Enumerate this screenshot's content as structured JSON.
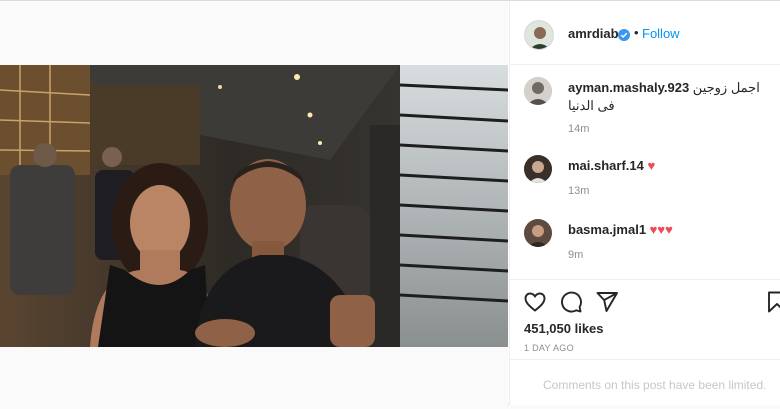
{
  "post": {
    "owner": {
      "username": "amrdiab",
      "verified_icon": "verified-badge-icon",
      "follow_label": "Follow",
      "separator": "•"
    },
    "comments": [
      {
        "username": "ayman.mashaly.923",
        "text": "اجمل زوجين فى الدنيا",
        "time": "14m"
      },
      {
        "username": "mai.sharf.14",
        "text": "♥",
        "time": "13m"
      },
      {
        "username": "basma.jmal1",
        "text": "♥♥♥",
        "time": "9m"
      }
    ],
    "likes": "451,050 likes",
    "date": "1 DAY AGO",
    "limited_notice": "Comments on this post have been limited."
  },
  "colors": {
    "link": "#0095f6",
    "heart": "#ed4956",
    "muted": "#8e8e8e",
    "border": "#efefef"
  },
  "icons": [
    "like-icon",
    "comment-icon",
    "share-icon",
    "save-icon"
  ]
}
